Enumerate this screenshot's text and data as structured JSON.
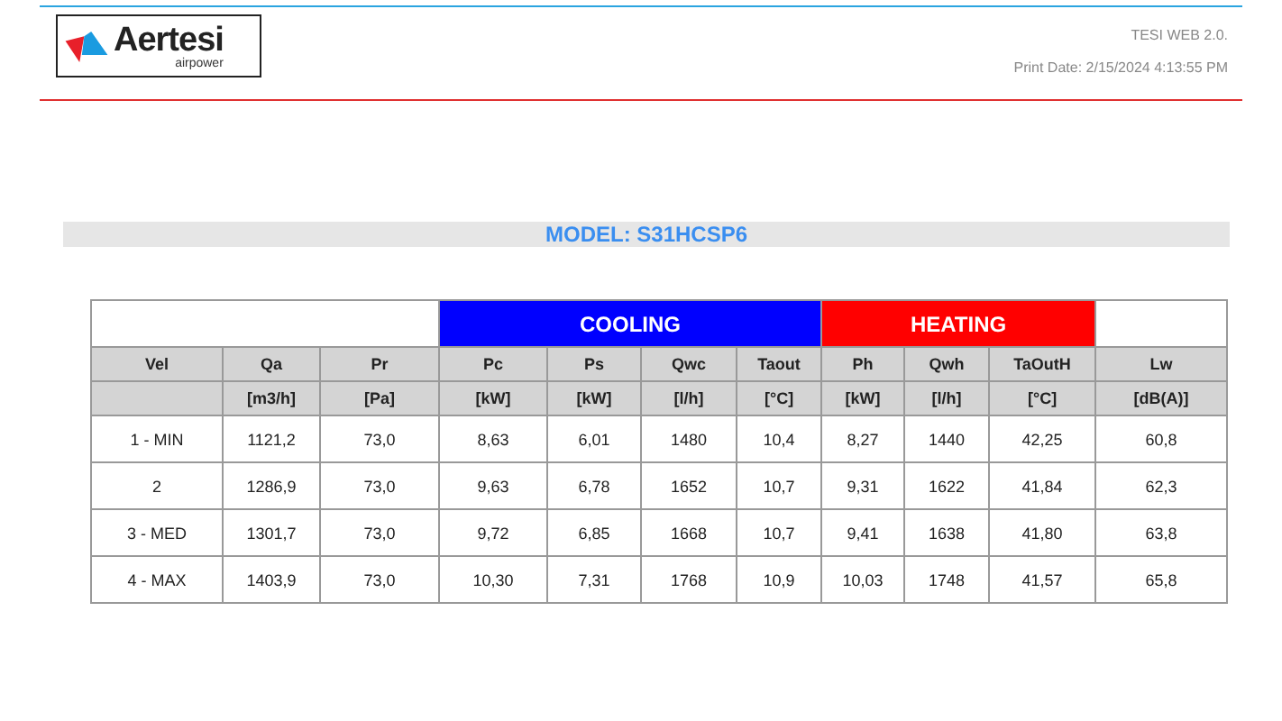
{
  "header": {
    "logo": {
      "name": "Aertesi",
      "tagline": "airpower"
    },
    "app": "TESI WEB 2.0.",
    "print_date": "Print Date: 2/15/2024 4:13:55 PM"
  },
  "model": "MODEL: S31HCSP6",
  "table": {
    "groups": [
      {
        "columns": [
          {
            "name": "Vel"
          },
          {
            "name": "Qa",
            "unit": "[m3/h]"
          },
          {
            "name": "Pr",
            "unit": "[Pa]"
          }
        ]
      },
      {
        "label": "COOLING",
        "color": "#0000ff",
        "columns": [
          {
            "name": "Pc",
            "unit": "[kW]"
          },
          {
            "name": "Ps",
            "unit": "[kW]"
          },
          {
            "name": "Qwc",
            "unit": "[l/h]"
          },
          {
            "name": "Taout",
            "unit": "[°C]"
          }
        ]
      },
      {
        "label": "HEATING",
        "color": "#ff0000",
        "columns": [
          {
            "name": "Ph",
            "unit": "[kW]"
          },
          {
            "name": "Qwh",
            "unit": "[l/h]"
          },
          {
            "name": "TaOutH",
            "unit": "[°C]"
          }
        ]
      },
      {
        "columns": [
          {
            "name": "Lw",
            "unit": "[dB(A)]"
          }
        ]
      }
    ],
    "rows": [
      [
        "1 - MIN",
        "1121,2",
        "73,0",
        "8,63",
        "6,01",
        "1480",
        "10,4",
        "8,27",
        "1440",
        "42,25",
        "60,8"
      ],
      [
        "2",
        "1286,9",
        "73,0",
        "9,63",
        "6,78",
        "1652",
        "10,7",
        "9,31",
        "1622",
        "41,84",
        "62,3"
      ],
      [
        "3 - MED",
        "1301,7",
        "73,0",
        "9,72",
        "6,85",
        "1668",
        "10,7",
        "9,41",
        "1638",
        "41,80",
        "63,8"
      ],
      [
        "4 - MAX",
        "1403,9",
        "73,0",
        "10,30",
        "7,31",
        "1768",
        "10,9",
        "10,03",
        "1748",
        "41,57",
        "65,8"
      ]
    ]
  }
}
